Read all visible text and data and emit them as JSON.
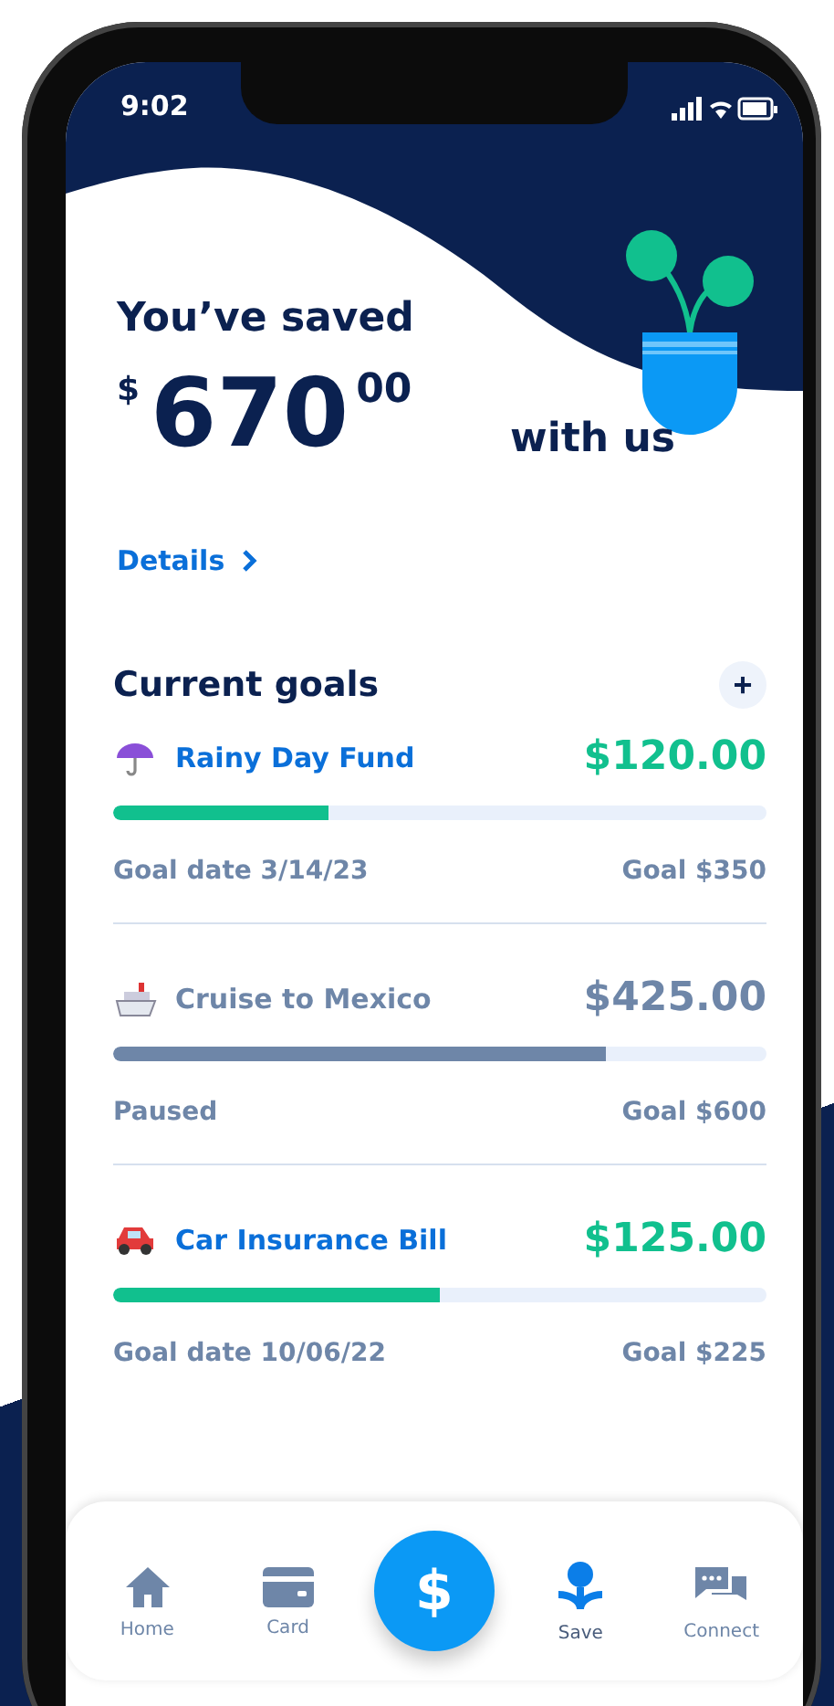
{
  "status_bar": {
    "time": "9:02"
  },
  "savings": {
    "title": "You’ve saved",
    "currency": "$",
    "whole": "670",
    "cents": "00",
    "suffix": "with us",
    "details_link": "Details"
  },
  "goals_section": {
    "title": "Current goals",
    "add_button": "+"
  },
  "goals": [
    {
      "name": "Rainy Day Fund",
      "amount": "$120.00",
      "paused": false,
      "level": 0.33,
      "status": "Goal date 3/14/23",
      "target": "Goal $350"
    },
    {
      "name": "Cruise to Mexico",
      "amount": "$425.00",
      "paused": true,
      "level": 0.755,
      "status": "Paused",
      "target": "Goal $600"
    },
    {
      "name": "Car Insurance Bill",
      "amount": "$125.00",
      "paused": false,
      "level": 0.5,
      "status": "Goal date 10/06/22",
      "target": "Goal $225"
    }
  ],
  "nav": {
    "items": [
      {
        "label": "Home",
        "selected": false
      },
      {
        "label": "Card",
        "selected": false
      },
      {
        "label": "Save",
        "selected": true
      },
      {
        "label": "Connect",
        "selected": false
      }
    ],
    "center_button": "$"
  }
}
